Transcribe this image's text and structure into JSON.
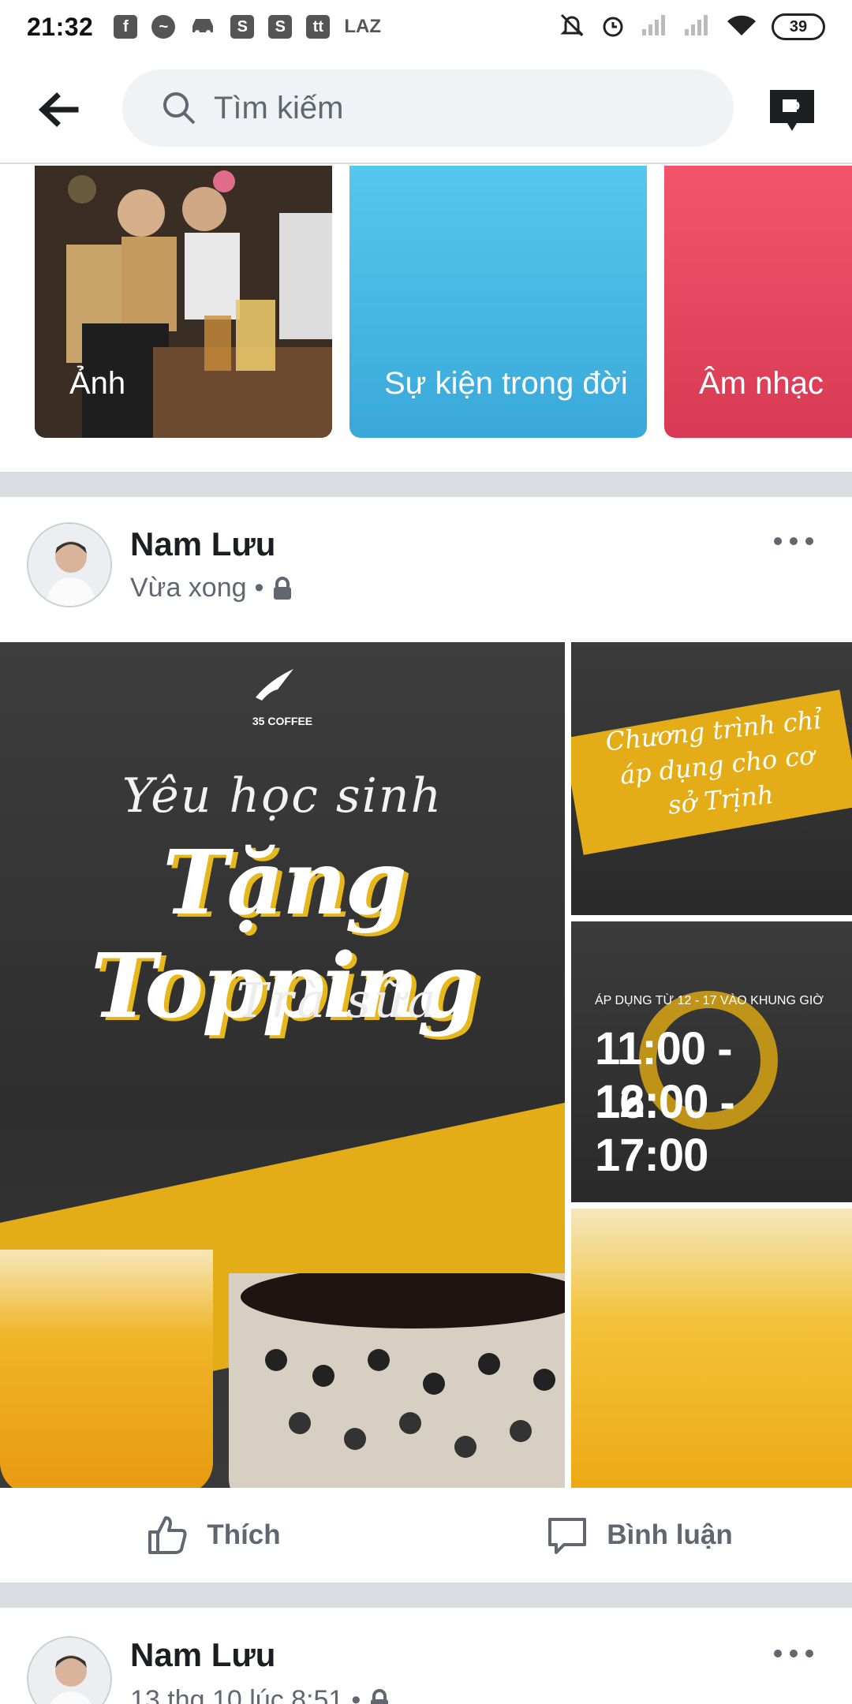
{
  "status_bar": {
    "time": "21:32",
    "notification_icons": [
      "facebook-icon",
      "messenger-icon",
      "car-icon",
      "shopee-icon",
      "shopee-icon",
      "tiki-icon"
    ],
    "laz": "LAZ",
    "battery": "39"
  },
  "header": {
    "search_placeholder": "Tìm kiếm"
  },
  "highlights": [
    {
      "label": "Ảnh"
    },
    {
      "label": "Sự kiện trong đời"
    },
    {
      "label": "Âm nhạc"
    }
  ],
  "posts": [
    {
      "author": "Nam Lưu",
      "time": "Vừa xong",
      "separator": "•",
      "privacy_icon": "lock-icon",
      "image": {
        "brand": "35 COFFEE",
        "line1": "Yêu học sinh",
        "line2": "Tặng Topping",
        "line3": "Trà sữa",
        "promo": "Chương trình chỉ áp dụng cho cơ sở Trịnh",
        "time_note": "ÁP DỤNG TỪ 12 - 17 VÀO KHUNG GIỜ",
        "time1": "11:00 - 12:00",
        "time2": "16:00 - 17:00"
      },
      "actions": {
        "like": "Thích",
        "comment": "Bình luận"
      }
    },
    {
      "author": "Nam Lưu",
      "time": "13 thg 10 lúc 8:51",
      "separator": "•"
    }
  ],
  "colors": {
    "accent_yellow": "#e4ad17",
    "divider": "#dadde1",
    "secondary_text": "#606770"
  }
}
